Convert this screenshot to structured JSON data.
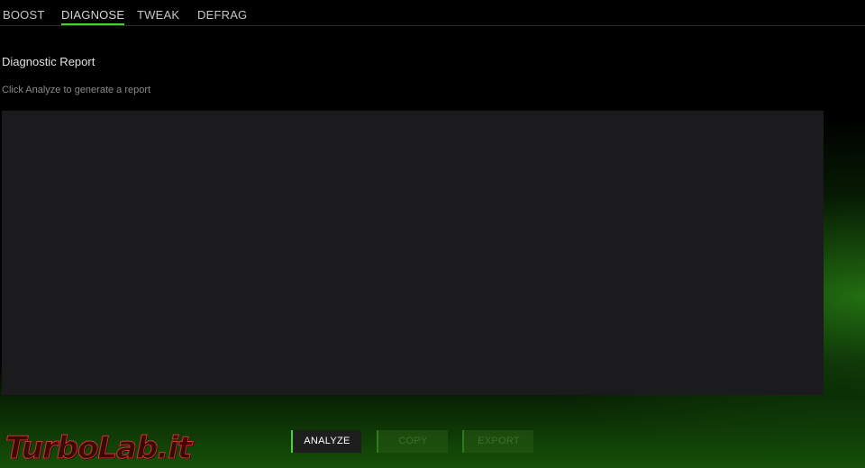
{
  "tabs": [
    {
      "label": "BOOST",
      "active": false
    },
    {
      "label": "DIAGNOSE",
      "active": true
    },
    {
      "label": "TWEAK",
      "active": false
    },
    {
      "label": "DEFRAG",
      "active": false
    }
  ],
  "report": {
    "title": "Diagnostic Report",
    "hint": "Click Analyze to generate a report",
    "content": ""
  },
  "buttons": {
    "analyze": {
      "label": "ANALYZE",
      "enabled": true
    },
    "copy": {
      "label": "COPY",
      "enabled": false
    },
    "export": {
      "label": "EXPORT",
      "enabled": false
    }
  },
  "watermark": {
    "text": "TurboLab.it"
  },
  "colors": {
    "accent": "#44d62c",
    "background": "#000000",
    "panel": "#1b1b1d"
  }
}
